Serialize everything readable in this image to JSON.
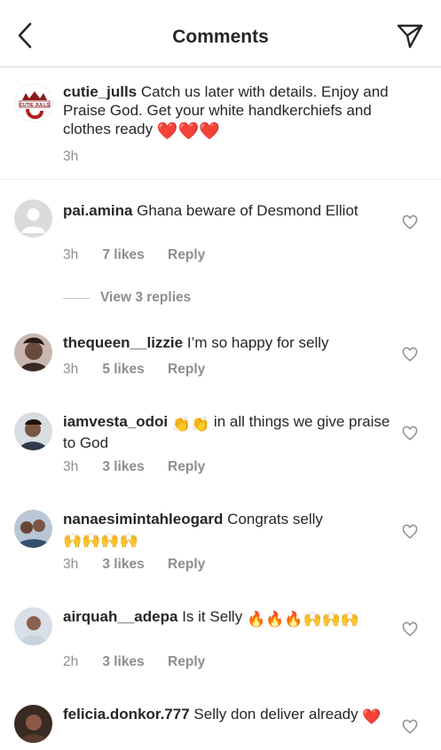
{
  "header": {
    "title": "Comments",
    "back_icon": "chevron-left-icon",
    "send_icon": "paper-plane-icon"
  },
  "caption": {
    "username": "cutie_julls",
    "text_1": "Catch us later with details. Enjoy and  Praise God. Get your white handkerchiefs and clothes ready",
    "emoji": "❤️❤️❤️",
    "time": "3h",
    "avatar_text": "CUTIE JULLS"
  },
  "comments": [
    {
      "username": "pai.amina",
      "text": "Ghana beware of Desmond Elliot",
      "time": "3h",
      "likes": "7 likes",
      "reply": "Reply"
    },
    {
      "username": "thequeen__lizzie",
      "text": "I’m so happy for selly",
      "time": "3h",
      "likes": "5 likes",
      "reply": "Reply"
    },
    {
      "username": "iamvesta_odoi",
      "text_pre": "👏👏",
      "text": "in all things we give praise to God",
      "time": "3h",
      "likes": "3 likes",
      "reply": "Reply"
    },
    {
      "username": "nanaesimintahleogard",
      "text": "Congrats selly",
      "text_post": "🙌🙌🙌🙌",
      "time": "3h",
      "likes": "3 likes",
      "reply": "Reply"
    },
    {
      "username": "airquah__adepa",
      "text": "Is it Selly",
      "text_post": "🔥🔥🔥🙌🙌🙌",
      "time": "2h",
      "likes": "3 likes",
      "reply": "Reply"
    },
    {
      "username": "felicia.donkor.777",
      "text": "Selly don deliver already",
      "text_post": "❤️"
    }
  ],
  "view_replies": "View 3 replies",
  "colors": {
    "text": "#262626",
    "secondary": "#8e8e8e",
    "divider": "#dbdbdb",
    "heart_red": "#e0282e"
  }
}
